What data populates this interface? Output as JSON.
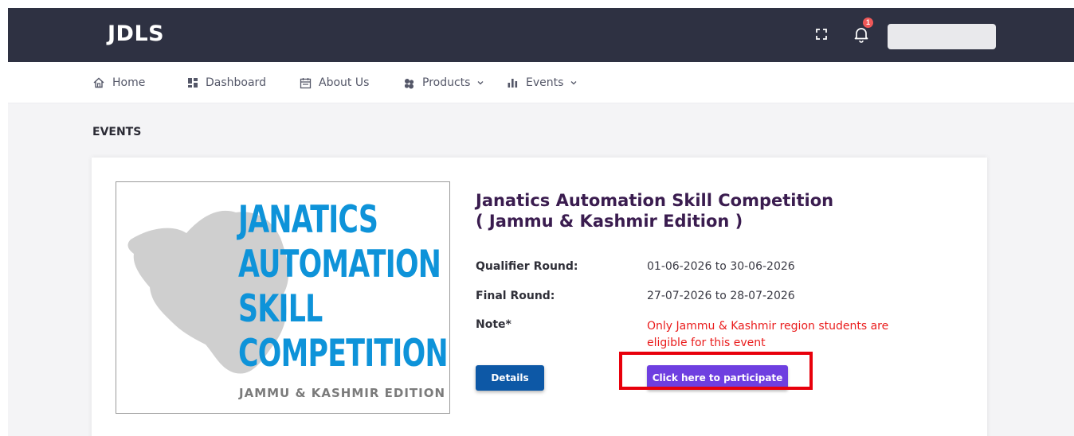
{
  "header": {
    "brand": "JDLS",
    "notification_count": "1",
    "colors": {
      "topbar": "#2e3142",
      "badge": "#ef5858"
    }
  },
  "nav": {
    "items": [
      {
        "label": "Home",
        "icon": "home-icon"
      },
      {
        "label": "Dashboard",
        "icon": "dashboard-icon"
      },
      {
        "label": "About Us",
        "icon": "calendar-icon"
      },
      {
        "label": "Products",
        "icon": "products-icon",
        "dropdown": true
      },
      {
        "label": "Events",
        "icon": "bar-chart-icon",
        "dropdown": true
      }
    ]
  },
  "page": {
    "section_title": "EVENTS"
  },
  "event": {
    "title_line1": "Janatics Automation Skill Competition",
    "title_line2": "( Jammu & Kashmir Edition )",
    "poster": {
      "lines": [
        "JANATICS",
        "AUTOMATION",
        "SKILL",
        "COMPETITION"
      ],
      "edition": "JAMMU & KASHMIR EDITION",
      "colors": {
        "headline": "#0e93d9",
        "map": "#cfcfcf",
        "edition": "#7b7b7b"
      }
    },
    "qualifier_label": "Qualifier Round:",
    "qualifier_value": "01-06-2026 to 30-06-2026",
    "final_label": "Final Round:",
    "final_value": "27-07-2026 to 28-07-2026",
    "note_label": "Note*",
    "note_text": "Only Jammu & Kashmir region students are eligible for this event",
    "details_button": "Details",
    "participate_button": "Click here to participate",
    "colors": {
      "title": "#3a1c4f",
      "note": "#ea1c1c",
      "details": "#0d58a6",
      "participate": "#6e3fe0",
      "highlight": "#e8000b"
    }
  }
}
